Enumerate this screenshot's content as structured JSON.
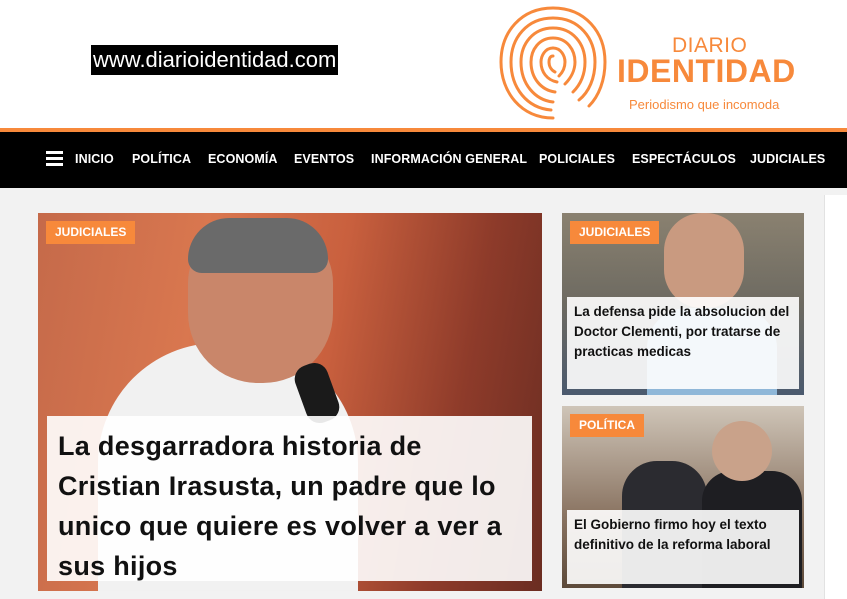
{
  "header": {
    "site_url": "www.diarioidentidad.com",
    "logo_line1": "DIARIO",
    "logo_line2": "IDENTIDAD",
    "tagline": "Periodismo que incomoda"
  },
  "nav": {
    "items": [
      "INICIO",
      "POLÍTICA",
      "ECONOMÍA",
      "EVENTOS",
      "INFORMACIÓN GENERAL",
      "POLICIALES",
      "ESPECTÁCULOS",
      "JUDICIALES"
    ]
  },
  "stories": [
    {
      "category": "JUDICIALES",
      "title": "La desgarradora historia de Cristian Irasusta, un padre que lo unico que quiere es volver a ver a sus hijos"
    },
    {
      "category": "JUDICIALES",
      "title": "La defensa pide la absolucion del Doctor Clementi, por tratarse de practicas medicas"
    },
    {
      "category": "POLÍTICA",
      "title": "El Gobierno firmo hoy el texto definitivo de la reforma laboral"
    }
  ],
  "colors": {
    "brand": "#f7893b",
    "nav_bg": "#000000"
  }
}
